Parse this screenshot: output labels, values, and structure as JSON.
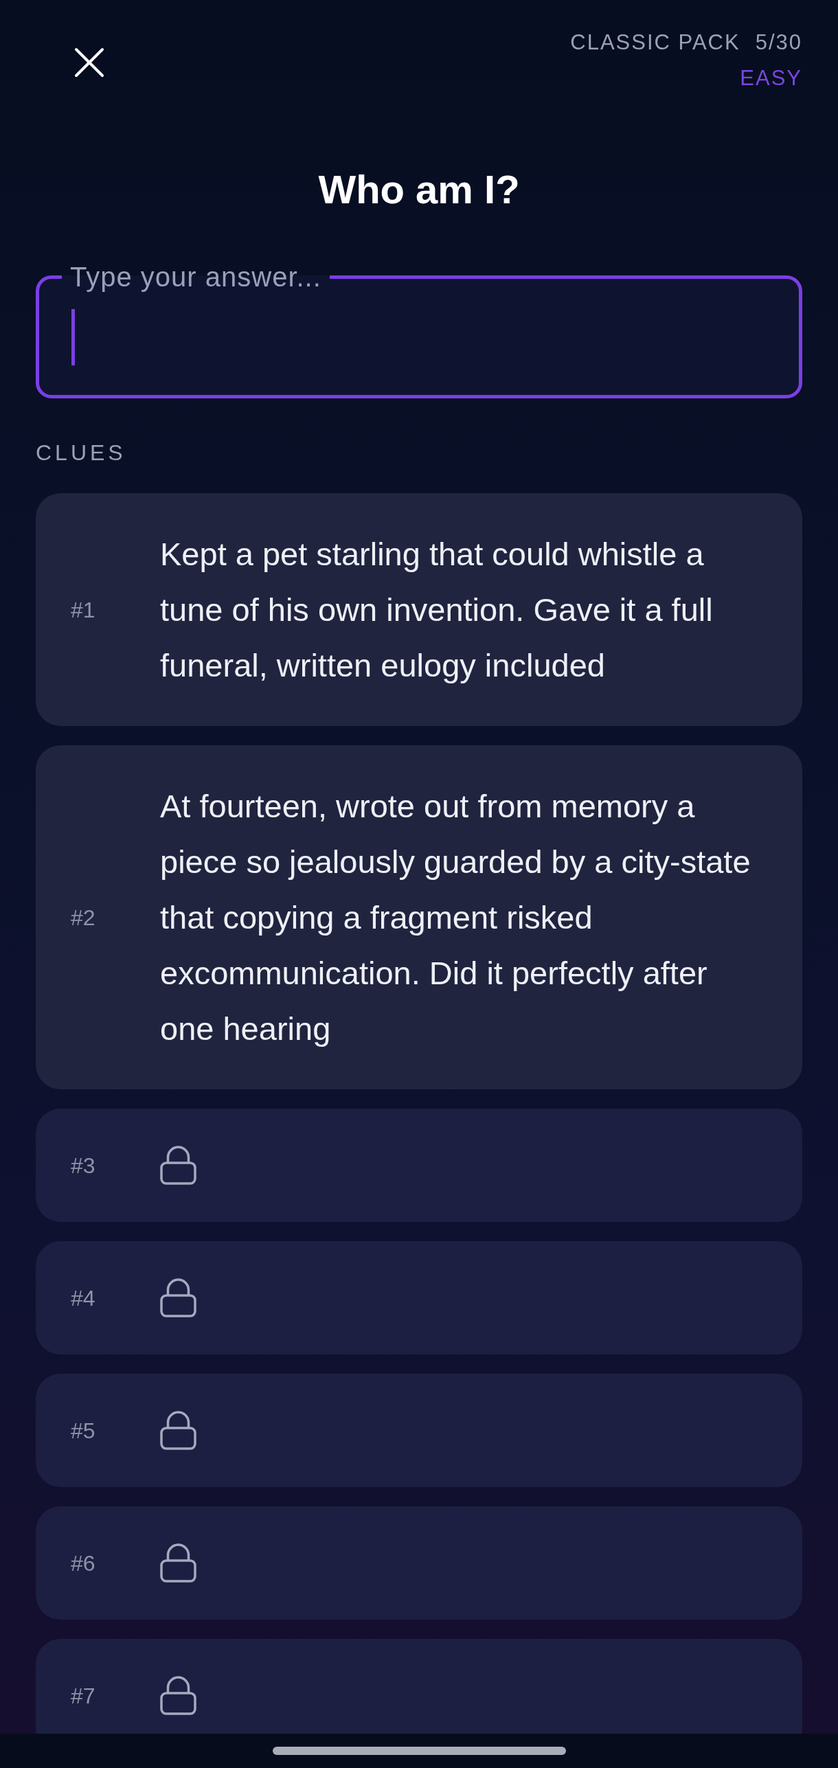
{
  "header": {
    "pack_name": "CLASSIC PACK",
    "progress": "5/30",
    "difficulty": "EASY"
  },
  "title": "Who am I?",
  "answer_field": {
    "placeholder": "Type your answer...",
    "focused": true
  },
  "clues_heading": "CLUES",
  "clues": [
    {
      "number": "#1",
      "locked": false,
      "text": "Kept a pet starling that could whistle a tune of his own invention. Gave it a full funeral, written eulogy included"
    },
    {
      "number": "#2",
      "locked": false,
      "text": "At fourteen, wrote out from memory a piece so jealously guarded by a city-state that copying a fragment risked excommunication. Did it perfectly after one hearing"
    },
    {
      "number": "#3",
      "locked": true
    },
    {
      "number": "#4",
      "locked": true
    },
    {
      "number": "#5",
      "locked": true
    },
    {
      "number": "#6",
      "locked": true
    },
    {
      "number": "#7",
      "locked": true
    }
  ]
}
